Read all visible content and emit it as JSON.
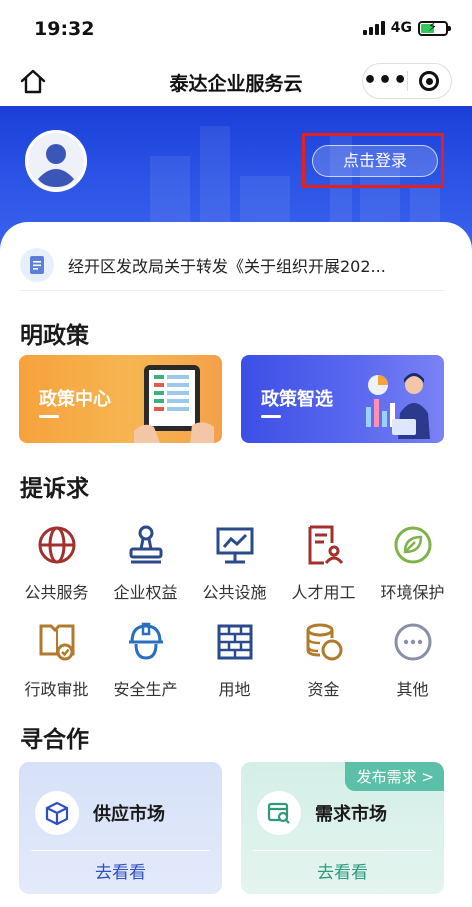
{
  "status_bar": {
    "time": "19:32",
    "network": "4G"
  },
  "nav": {
    "title": "泰达企业服务云"
  },
  "header": {
    "login_label": "点击登录"
  },
  "notice": {
    "text": "经开区发改局关于转发《关于组织开展202..."
  },
  "policy_section": {
    "title": "明政策",
    "cards": [
      {
        "label": "政策中心"
      },
      {
        "label": "政策智选"
      }
    ]
  },
  "request_section": {
    "title": "提诉求",
    "items": [
      {
        "label": "公共服务",
        "icon": "globe-icon",
        "color": "#a2302c"
      },
      {
        "label": "企业权益",
        "icon": "stamp-icon",
        "color": "#2a4a8c"
      },
      {
        "label": "公共设施",
        "icon": "presentation-icon",
        "color": "#2a4a8c"
      },
      {
        "label": "人才用工",
        "icon": "resume-icon",
        "color": "#a2302c"
      },
      {
        "label": "环境保护",
        "icon": "leaf-icon",
        "color": "#7fb34a"
      },
      {
        "label": "行政审批",
        "icon": "approval-icon",
        "color": "#b27a2c"
      },
      {
        "label": "安全生产",
        "icon": "helmet-icon",
        "color": "#2a6fbf"
      },
      {
        "label": "用地",
        "icon": "bricks-icon",
        "color": "#2a4a8c"
      },
      {
        "label": "资金",
        "icon": "coins-icon",
        "color": "#b27a2c"
      },
      {
        "label": "其他",
        "icon": "more-icon",
        "color": "#8a8fa8"
      }
    ]
  },
  "coop_section": {
    "title": "寻合作",
    "supply": {
      "title": "供应市场",
      "link": "去看看"
    },
    "demand": {
      "title": "需求市场",
      "link": "去看看",
      "badge": "发布需求 >"
    }
  }
}
